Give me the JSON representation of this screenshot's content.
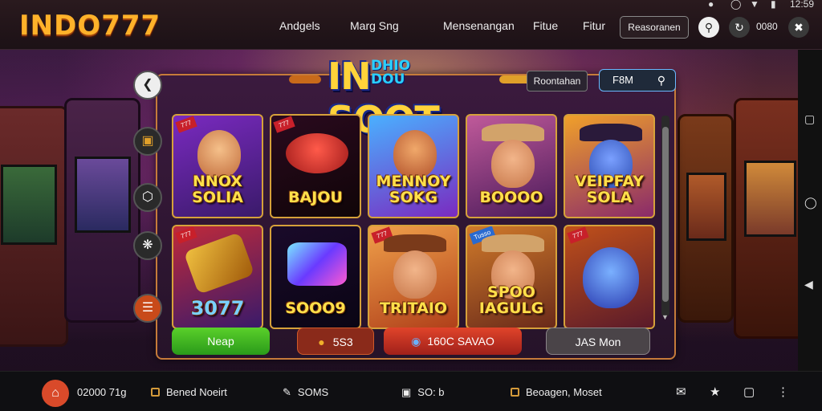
{
  "header": {
    "logo": "INDO777",
    "nav_items": [
      "Andgels",
      "Marg Sng",
      "Mensenangan",
      "Fitue",
      "Fitur"
    ],
    "nav_button": "Reasoranen",
    "status_time": "12:59",
    "counter": "0080"
  },
  "game": {
    "title_main": "IN",
    "title_small_1": "DHIO",
    "title_small_2": "DOU",
    "title_suffix": "SOOT",
    "pill_label": "Roontahan",
    "search_value": "F8M",
    "tiles": [
      {
        "label_1": "NNOX",
        "label_2": "SOLIA",
        "badge": "777"
      },
      {
        "label_1": "",
        "label_2": "BAJOU",
        "badge": "777"
      },
      {
        "label_1": "MENNOY",
        "label_2": "SOKG",
        "badge": ""
      },
      {
        "label_1": "",
        "label_2": "BOOOO",
        "badge": ""
      },
      {
        "label_1": "VEIPFAY",
        "label_2": "SOLA",
        "badge": ""
      },
      {
        "label_1": "",
        "label_2": "3077",
        "badge": "777"
      },
      {
        "label_1": "",
        "label_2": "SOOO9",
        "badge": ""
      },
      {
        "label_1": "",
        "label_2": "TRITAIO",
        "badge": "777"
      },
      {
        "label_1": "SPOO",
        "label_2": "IAGULG",
        "badge": "Tusso"
      },
      {
        "label_1": "",
        "label_2": "",
        "badge": "777"
      }
    ],
    "buttons": {
      "green": "Neap",
      "coins": "5S3",
      "red": "160C SAVAO",
      "gray": "JAS Mon"
    }
  },
  "bottom_bar": {
    "item1": "02000 71g",
    "item2": "Bened Noeirt",
    "item3": "SOMS",
    "item4": "SO: b",
    "item5": "Beoagen, Moset"
  },
  "colors": {
    "logo": "#ffb22a",
    "panel_border": "#c67b3a",
    "green_button": "#3fb61f",
    "red_button": "#d0331f",
    "home_button": "#d94a2a"
  }
}
